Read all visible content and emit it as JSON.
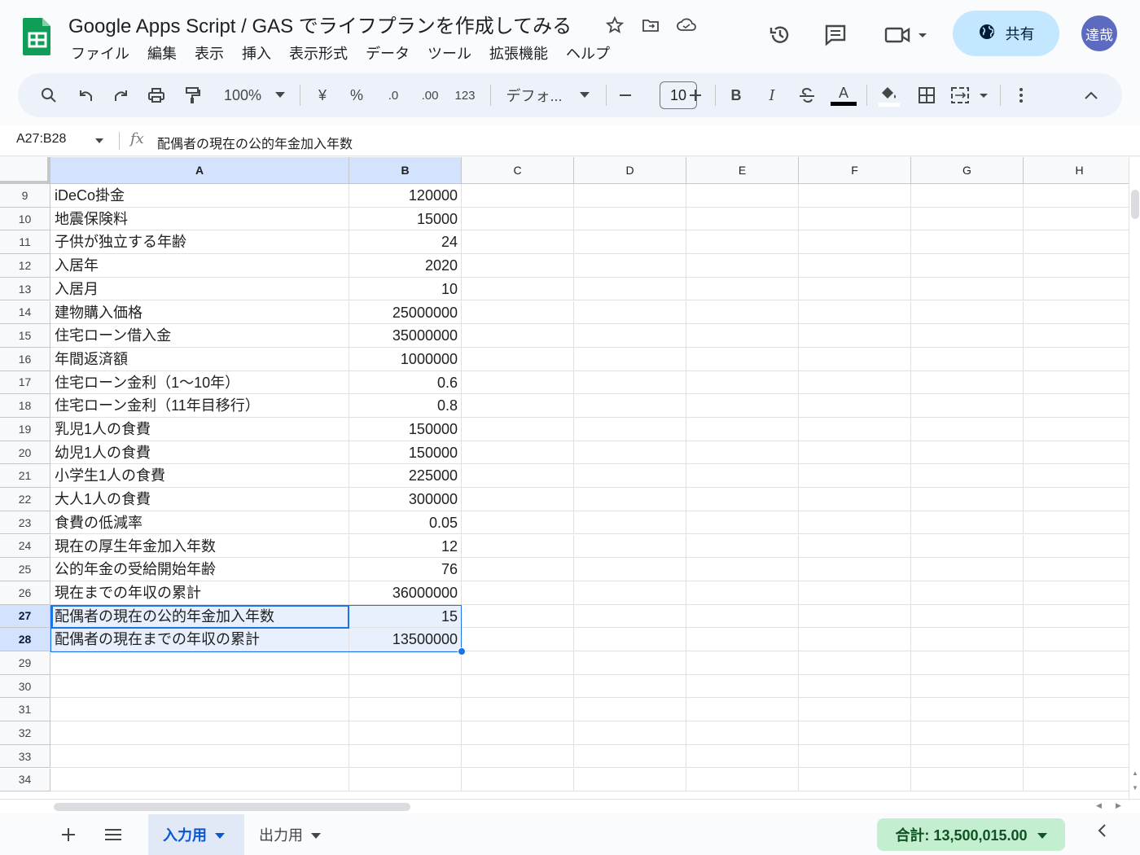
{
  "header": {
    "title": "Google Apps Script / GAS でライフプランを作成してみる",
    "menu": [
      "ファイル",
      "編集",
      "表示",
      "挿入",
      "表示形式",
      "データ",
      "ツール",
      "拡張機能",
      "ヘルプ"
    ],
    "share_label": "共有",
    "avatar_initials": "達哉"
  },
  "toolbar": {
    "zoom": "100%",
    "currency": "¥",
    "percent": "%",
    "decrease_decimal": ".0",
    "increase_decimal": ".00",
    "number_format": "123",
    "font": "デフォ...",
    "font_size": "10",
    "bold": "B",
    "italic": "I",
    "text_color_label": "A"
  },
  "formula_bar": {
    "name_box": "A27:B28",
    "fx": "fx",
    "content": "配偶者の現在の公的年金加入年数"
  },
  "columns": [
    "A",
    "B",
    "C",
    "D",
    "E",
    "F",
    "G",
    "H"
  ],
  "rows": [
    {
      "num": "9",
      "a": "iDeCo掛金",
      "b": "120000"
    },
    {
      "num": "10",
      "a": "地震保険料",
      "b": "15000"
    },
    {
      "num": "11",
      "a": "子供が独立する年齢",
      "b": "24"
    },
    {
      "num": "12",
      "a": "入居年",
      "b": "2020"
    },
    {
      "num": "13",
      "a": "入居月",
      "b": "10"
    },
    {
      "num": "14",
      "a": "建物購入価格",
      "b": "25000000"
    },
    {
      "num": "15",
      "a": "住宅ローン借入金",
      "b": "35000000"
    },
    {
      "num": "16",
      "a": "年間返済額",
      "b": "1000000"
    },
    {
      "num": "17",
      "a": "住宅ローン金利（1〜10年）",
      "b": "0.6"
    },
    {
      "num": "18",
      "a": "住宅ローン金利（11年目移行）",
      "b": "0.8"
    },
    {
      "num": "19",
      "a": "乳児1人の食費",
      "b": "150000"
    },
    {
      "num": "20",
      "a": "幼児1人の食費",
      "b": "150000"
    },
    {
      "num": "21",
      "a": "小学生1人の食費",
      "b": "225000"
    },
    {
      "num": "22",
      "a": "大人1人の食費",
      "b": "300000"
    },
    {
      "num": "23",
      "a": "食費の低減率",
      "b": "0.05"
    },
    {
      "num": "24",
      "a": "現在の厚生年金加入年数",
      "b": "12"
    },
    {
      "num": "25",
      "a": "公的年金の受給開始年齢",
      "b": "76"
    },
    {
      "num": "26",
      "a": "現在までの年収の累計",
      "b": "36000000"
    },
    {
      "num": "27",
      "a": "配偶者の現在の公的年金加入年数",
      "b": "15",
      "selected": true
    },
    {
      "num": "28",
      "a": "配偶者の現在までの年収の累計",
      "b": "13500000",
      "selected": true
    },
    {
      "num": "29",
      "a": "",
      "b": ""
    },
    {
      "num": "30",
      "a": "",
      "b": ""
    },
    {
      "num": "31",
      "a": "",
      "b": ""
    },
    {
      "num": "32",
      "a": "",
      "b": ""
    },
    {
      "num": "33",
      "a": "",
      "b": ""
    },
    {
      "num": "34",
      "a": "",
      "b": ""
    }
  ],
  "sheets": {
    "active": "入力用",
    "other": "出力用"
  },
  "status": {
    "sum": "合計: 13,500,015.00"
  },
  "colors": {
    "selection_header": "#d3e3fd",
    "selection_fill": "#e8f0fe",
    "selection_border": "#1a73e8",
    "share_button": "#c2e7ff",
    "sum_pill": "#c4eed0"
  }
}
